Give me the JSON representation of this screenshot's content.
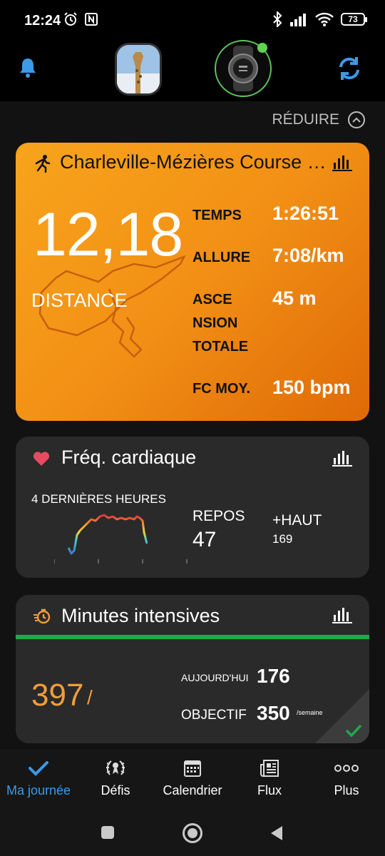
{
  "status_bar": {
    "time": "12:24",
    "battery": "73"
  },
  "header": {
    "bell": "bell-icon",
    "sync": "sync-icon"
  },
  "reduire": {
    "label": "RÉDUIRE"
  },
  "activity": {
    "title": "Charleville-Mézières Course à pied",
    "distance_value": "12,18",
    "distance_label": "DISTANCE",
    "stats": [
      {
        "label": "TEMPS",
        "value": "1:26:51"
      },
      {
        "label": "ALLURE",
        "value": "7:08/km"
      },
      {
        "label": "ASCE\nNSION\nTOTALE",
        "value": "45 m"
      },
      {
        "label": "FC MOY.",
        "value": "150 bpm"
      }
    ]
  },
  "heart_rate": {
    "title": "Fréq. cardiaque",
    "subtitle": "4 DERNIÈRES HEURES",
    "rest_label": "REPOS",
    "rest_value": "47",
    "high_label": "+HAUT",
    "high_value": "169"
  },
  "intensity": {
    "title": "Minutes intensives",
    "value": "397",
    "slash": "/",
    "today_label": "AUJOURD'HUI",
    "today_value": "176",
    "goal_label": "OBJECTIF",
    "goal_value": "350",
    "goal_unit": "/semaine"
  },
  "nav": [
    {
      "label": "Ma journée",
      "icon": "check-icon",
      "active": true
    },
    {
      "label": "Défis",
      "icon": "laurel-icon"
    },
    {
      "label": "Calendrier",
      "icon": "calendar-icon"
    },
    {
      "label": "Flux",
      "icon": "news-icon"
    },
    {
      "label": "Plus",
      "icon": "more-icon"
    }
  ],
  "colors": {
    "accent": "#3b9be8",
    "orange": "#f29015",
    "green": "#1eaa4b",
    "heart": "#e84a5f",
    "intensity": "#f29d3a"
  }
}
